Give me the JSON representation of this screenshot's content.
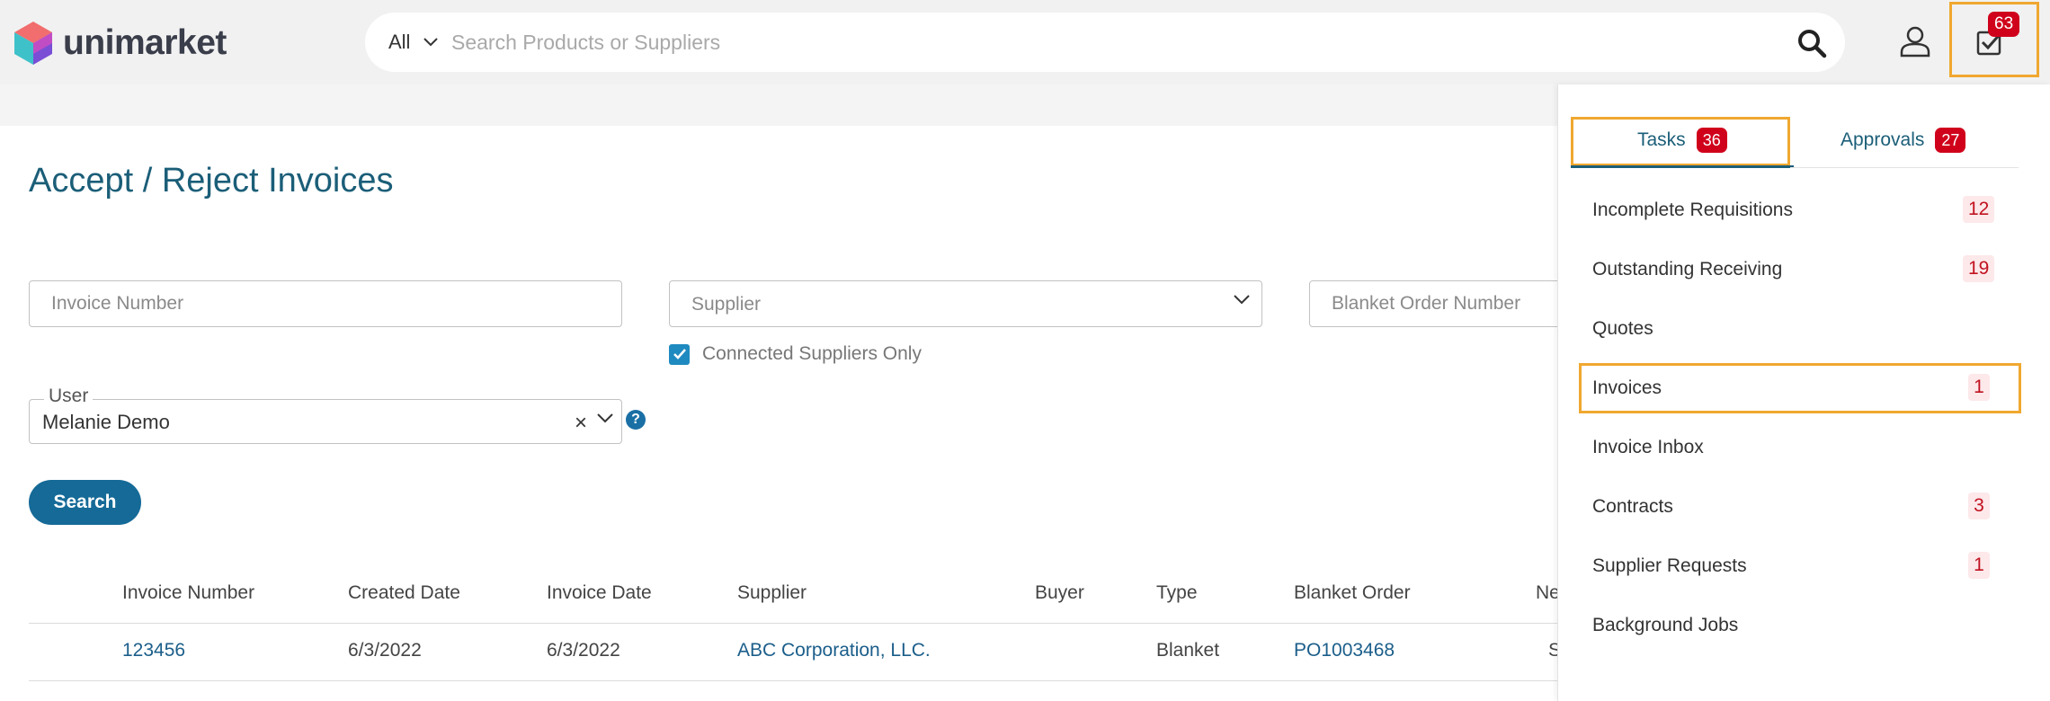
{
  "header": {
    "brand": "unimarket",
    "search": {
      "scope": "All",
      "placeholder": "Search Products or Suppliers"
    },
    "tasks_count": "63"
  },
  "page": {
    "title": "Accept / Reject Invoices",
    "filters": {
      "invoice_number_placeholder": "Invoice Number",
      "supplier_placeholder": "Supplier",
      "blanket_order_placeholder": "Blanket Order Number",
      "connected_suppliers_label": "Connected Suppliers Only",
      "connected_suppliers_checked": true,
      "user_label": "User",
      "user_value": "Melanie Demo",
      "user_clear": "×"
    },
    "search_button": "Search",
    "table": {
      "columns": [
        "Invoice Number",
        "Created Date",
        "Invoice Date",
        "Supplier",
        "Buyer",
        "Type",
        "Blanket Order",
        "Ne"
      ],
      "rows": [
        {
          "invoice_number": "123456",
          "created_date": "6/3/2022",
          "invoice_date": "6/3/2022",
          "supplier": "ABC Corporation, LLC.",
          "buyer": "",
          "type": "Blanket",
          "blanket_order": "PO1003468",
          "ne": "S"
        }
      ]
    }
  },
  "panel": {
    "tabs": [
      {
        "label": "Tasks",
        "count": "36"
      },
      {
        "label": "Approvals",
        "count": "27"
      }
    ],
    "tasks": [
      {
        "label": "Incomplete Requisitions",
        "count": "12"
      },
      {
        "label": "Outstanding Receiving",
        "count": "19"
      },
      {
        "label": "Quotes",
        "count": ""
      },
      {
        "label": "Invoices",
        "count": "1"
      },
      {
        "label": "Invoice Inbox",
        "count": ""
      },
      {
        "label": "Contracts",
        "count": "3"
      },
      {
        "label": "Supplier Requests",
        "count": "1"
      },
      {
        "label": "Background Jobs",
        "count": ""
      }
    ]
  },
  "colors": {
    "accent": "#1b5e78",
    "badge": "#d0021b",
    "highlight": "#f0a830",
    "button": "#156a97"
  }
}
